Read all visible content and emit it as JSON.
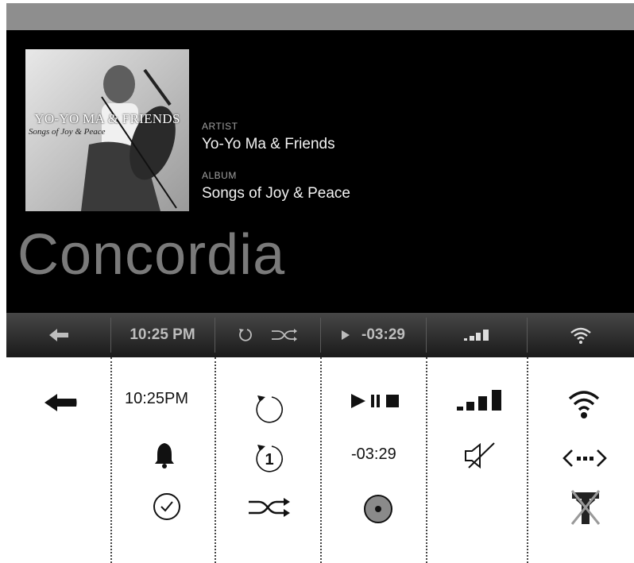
{
  "now_playing": {
    "album_art": {
      "title_text": "YO-YO MA & FRIENDS",
      "subtitle_text": "Songs of Joy & Peace"
    },
    "artist_label": "ARTIST",
    "artist": "Yo-Yo Ma & Friends",
    "album_label": "ALBUM",
    "album": "Songs of Joy & Peace",
    "track_title": "Concordia"
  },
  "status_bar": {
    "back_icon": "left-arrow-icon",
    "clock": "10:25 PM",
    "repeat_icon": "repeat-icon",
    "shuffle_icon": "shuffle-icon",
    "play_icon": "play-icon",
    "time_remaining": "-03:29",
    "signal_icon": "signal-bars-icon",
    "wifi_icon": "wifi-icon"
  },
  "legend": {
    "back": {
      "icon": "left-arrow-icon"
    },
    "time": {
      "clock_text": "10:25PM",
      "icons": [
        "alarm-bell-icon",
        "clock-icon"
      ]
    },
    "repeat": {
      "icons": [
        "repeat-icon",
        "repeat-one-icon",
        "shuffle-icon"
      ]
    },
    "playback": {
      "icons": [
        "play-pause-stop-icon",
        "disc-icon"
      ],
      "time_text": "-03:29"
    },
    "volume": {
      "icons": [
        "signal-bars-icon",
        "mute-icon"
      ]
    },
    "connection": {
      "icons": [
        "wifi-icon",
        "link-icon",
        "no-antenna-icon"
      ]
    }
  },
  "colors": {
    "screen_bg": "#000000",
    "title_gray": "#7a7a7a",
    "status_bar_text": "#bdbdbd",
    "frame_top": "#8e8e8e"
  }
}
